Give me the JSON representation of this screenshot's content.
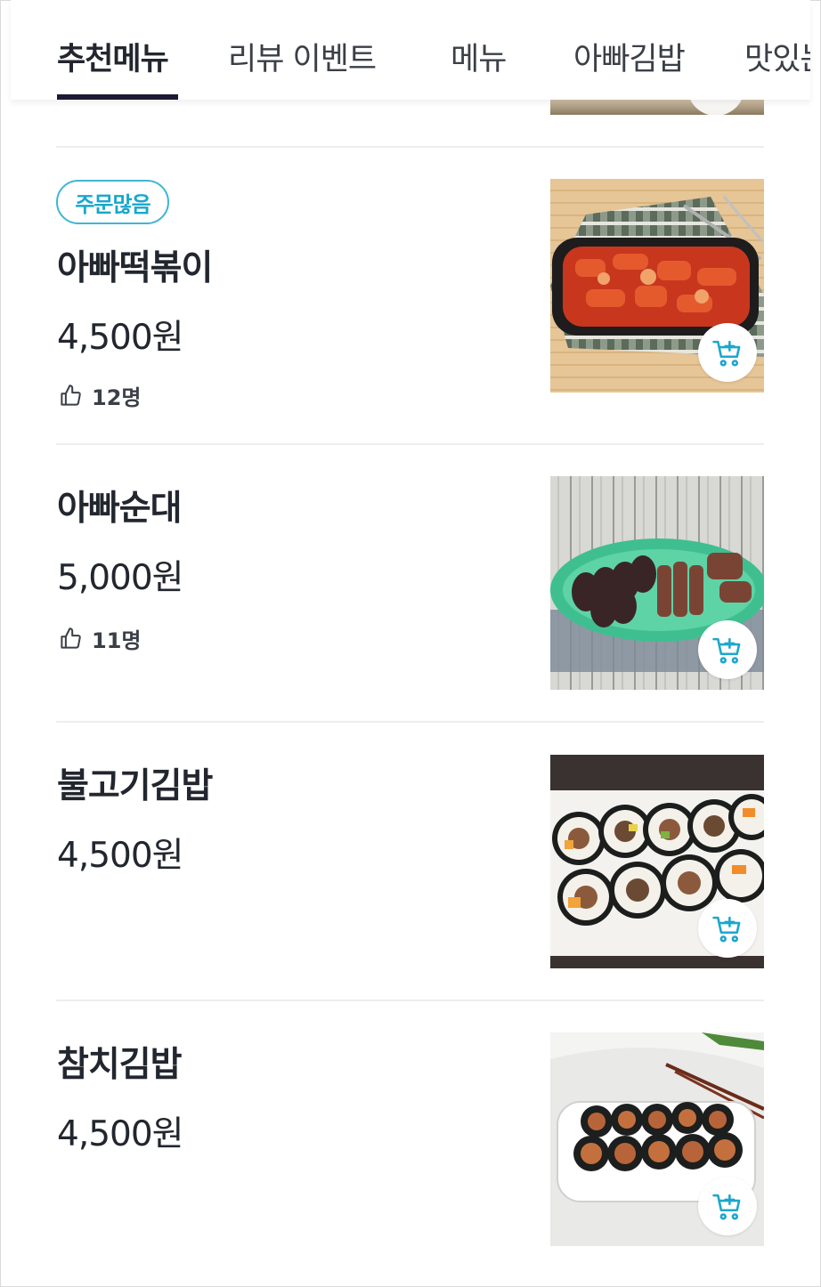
{
  "tabs": [
    {
      "label": "추천메뉴",
      "active": true
    },
    {
      "label": "리뷰 이벤트",
      "active": false
    },
    {
      "label": "메뉴",
      "active": false
    },
    {
      "label": "아빠김밥",
      "active": false
    },
    {
      "label": "맛있는",
      "active": false
    }
  ],
  "menu_items": [
    {
      "badge": "주문많음",
      "name": "아빠떡볶이",
      "price": "4,500원",
      "likes": "12명",
      "image_icon": "tteokbokki-photo",
      "cart_icon": "add-to-cart-icon"
    },
    {
      "badge": "",
      "name": "아빠순대",
      "price": "5,000원",
      "likes": "11명",
      "image_icon": "sundae-photo",
      "cart_icon": "add-to-cart-icon"
    },
    {
      "badge": "",
      "name": "불고기김밥",
      "price": "4,500원",
      "likes": "",
      "image_icon": "bulgogi-kimbap-photo",
      "cart_icon": "add-to-cart-icon"
    },
    {
      "badge": "",
      "name": "참치김밥",
      "price": "4,500원",
      "likes": "",
      "image_icon": "tuna-kimbap-photo",
      "cart_icon": "add-to-cart-icon"
    }
  ],
  "colors": {
    "accent": "#19a7cc",
    "tab_indicator": "#1c1a33",
    "text": "#22262e",
    "divider": "#ededed"
  }
}
